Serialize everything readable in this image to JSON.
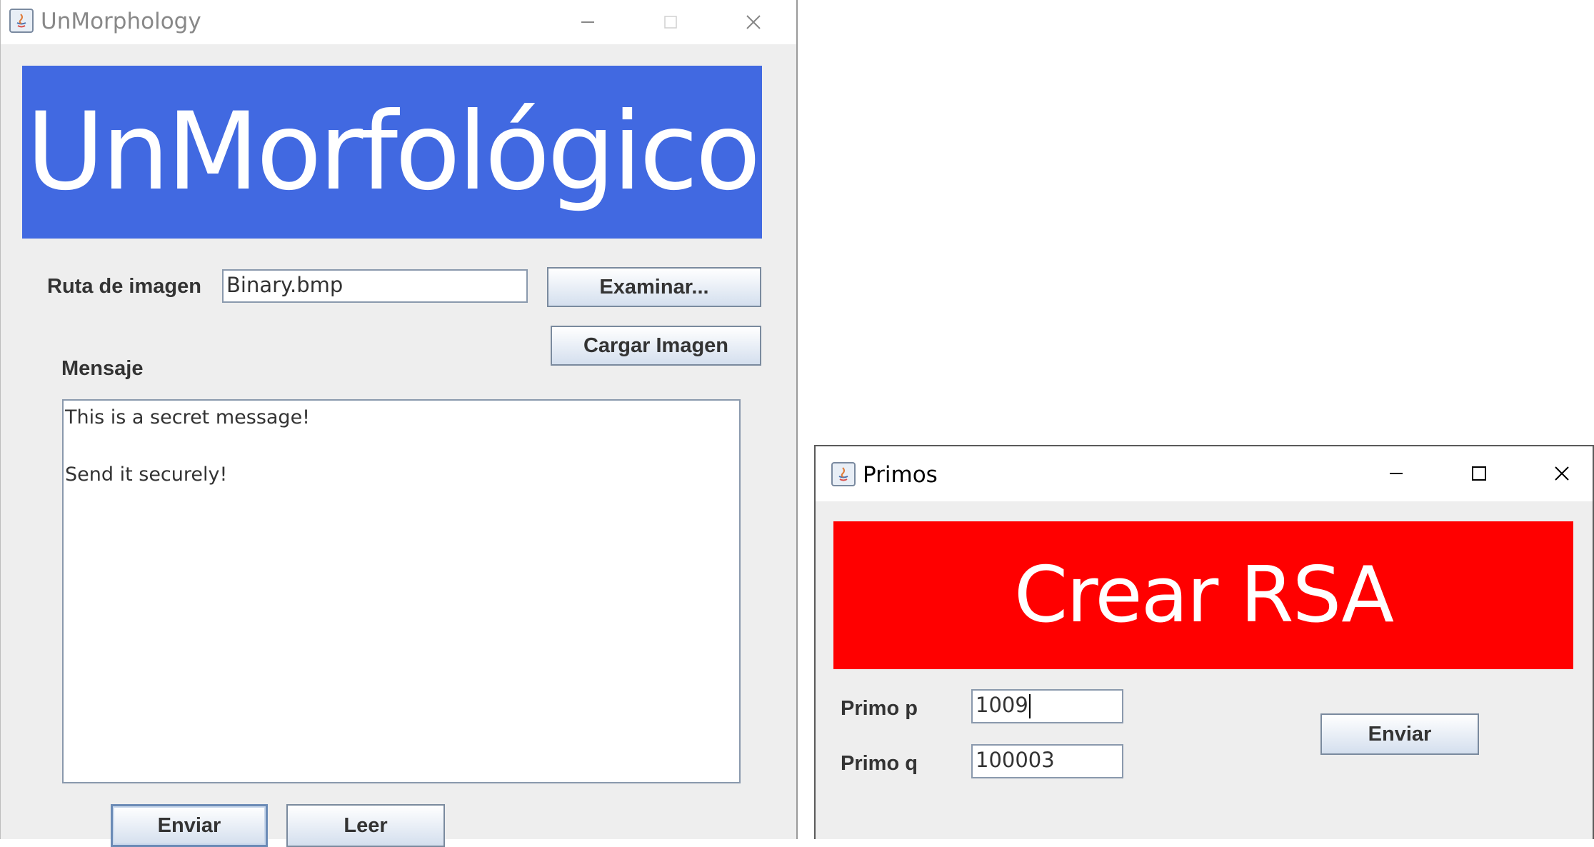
{
  "main_window": {
    "title": "UnMorphology",
    "banner": "UnMorfológico",
    "image_path_label": "Ruta de imagen",
    "image_path_value": "Binary.bmp",
    "browse_button": "Examinar...",
    "load_image_button": "Cargar Imagen",
    "message_label": "Mensaje",
    "message_text": "This is a secret message!\n\nSend it securely!",
    "send_button": "Enviar",
    "read_button": "Leer"
  },
  "primos_window": {
    "title": "Primos",
    "banner": "Crear RSA",
    "prime_p_label": "Primo p",
    "prime_p_value": "1009",
    "prime_q_label": "Primo q",
    "prime_q_value": "100003",
    "send_button": "Enviar"
  },
  "colors": {
    "blue_banner": "#4169e1",
    "red_banner": "#ff0000",
    "window_background": "#eeeeee"
  },
  "icons": [
    "java-app-icon",
    "minimize-icon",
    "maximize-icon",
    "close-icon"
  ]
}
